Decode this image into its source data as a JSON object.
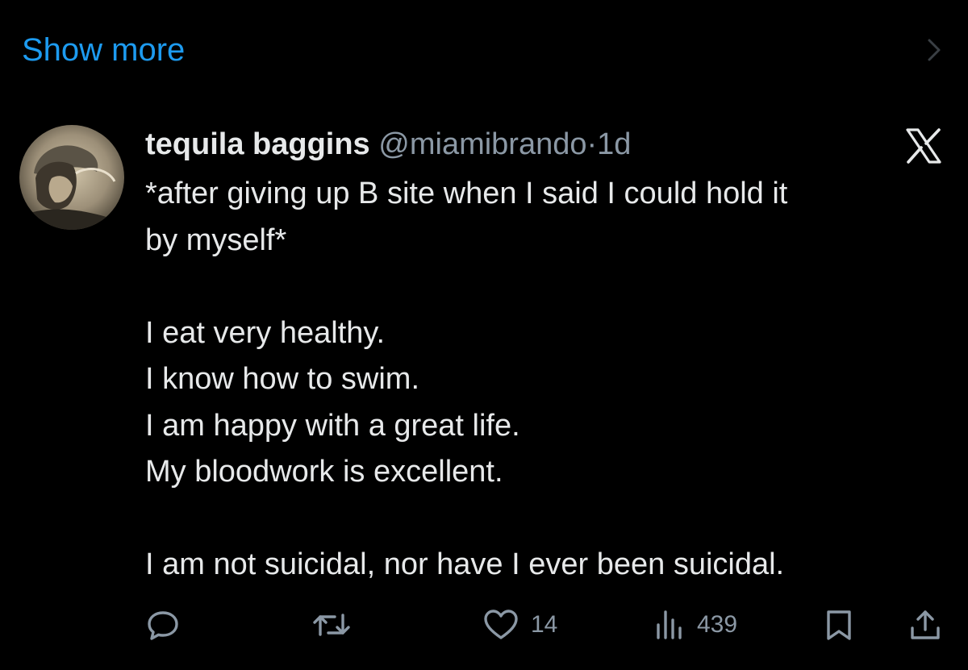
{
  "thread": {
    "show_more_label": "Show more"
  },
  "tweet": {
    "author_name": "tequila baggins",
    "handle": "@miamibrando",
    "separator": "·",
    "time": "1d",
    "body_lines": [
      "*after giving up B site when I said I could hold it",
      "by myself*",
      "",
      "I eat very healthy.",
      "I know how to swim.",
      "I am happy with a great life.",
      "My bloodwork is excellent.",
      "",
      "I am not suicidal, nor have I ever been suicidal."
    ],
    "actions": {
      "reply_icon": "reply-icon",
      "retweet_icon": "retweet-icon",
      "like_icon": "heart-icon",
      "like_count": "14",
      "views_icon": "views-icon",
      "view_count": "439",
      "bookmark_icon": "bookmark-icon",
      "share_icon": "share-icon"
    }
  },
  "colors": {
    "background": "#000000",
    "text": "#e7e9ea",
    "secondary": "#8b98a5",
    "link": "#1d9bf0"
  }
}
